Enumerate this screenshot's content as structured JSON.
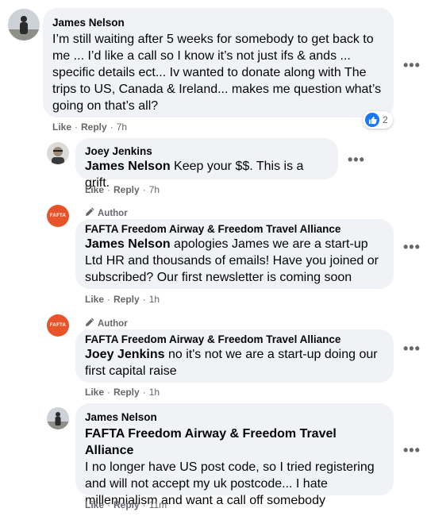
{
  "actions": {
    "like": "Like",
    "reply": "Reply"
  },
  "more_glyph": "•••",
  "author_badge": "Author",
  "comment": {
    "author": "James Nelson",
    "text": "I’m still waiting after 5 weeks for somebody to get back to me ... I’d like a call so I know it’s not just ifs & ands ... specific details ect... Iv wanted to donate along with The trips to US, Canada & Ireland... makes me question what’s going on that’s all?",
    "time": "7h",
    "reaction_count": "2"
  },
  "replies": [
    {
      "author": "Joey Jenkins",
      "mention": "James Nelson",
      "text": " Keep your $$. This is a grift.",
      "time": "7h"
    },
    {
      "author": "FAFTA Freedom Airway & Freedom Travel Alliance",
      "avatar_text": "FAFTA",
      "mention": "James Nelson",
      "text": " apologies James we are a start-up Ltd HR and thousands of emails! Have you joined or subscribed? Our first newsletter is coming soon",
      "time": "1h"
    },
    {
      "author": "FAFTA Freedom Airway & Freedom Travel Alliance",
      "avatar_text": "FAFTA",
      "mention": "Joey Jenkins",
      "text": " no it's not we are a start-up doing our first capital raise",
      "time": "1h"
    },
    {
      "author": "James Nelson",
      "mention": "FAFTA Freedom Airway & Freedom Travel Alliance",
      "text": "I no longer have US post code, so I tried registering and will not accept my uk postcode... I hate millennialism and want a call off somebody",
      "time": "11m"
    }
  ],
  "colors": {
    "bubble": "#f0f2f5",
    "meta": "#65676b",
    "like_blue": "#1877f2",
    "fafta_orange": "#e8542a"
  }
}
